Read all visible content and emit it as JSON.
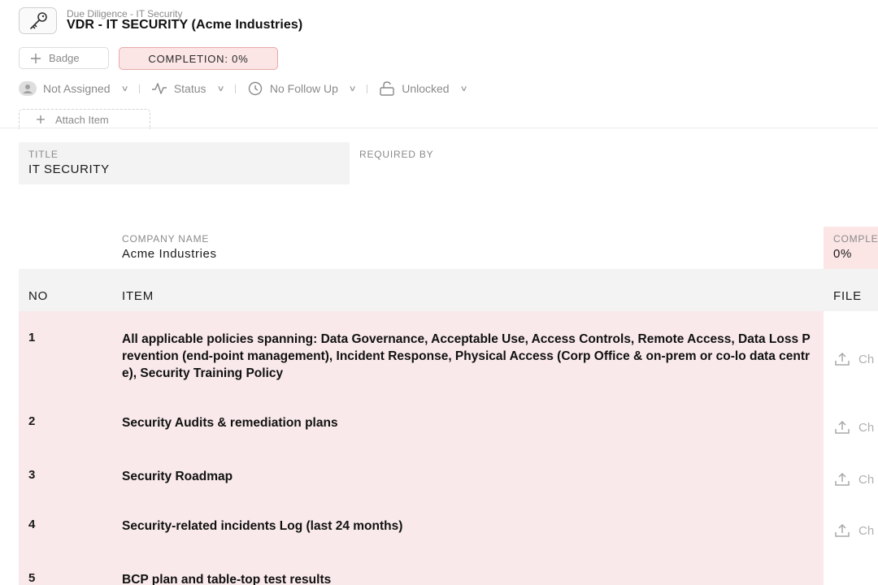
{
  "header": {
    "icon": "key-icon",
    "breadcrumb": "Due Diligence - IT Security",
    "title": "VDR - IT SECURITY (Acme Industries)"
  },
  "badge_button": {
    "label": "Badge",
    "icon": "plus-icon"
  },
  "completion_pill": {
    "label": "COMPLETION: 0%",
    "value_percent": 0
  },
  "properties": [
    {
      "label": "Not Assigned",
      "icon": "user-avatar-icon"
    },
    {
      "label": "Status",
      "icon": "activity-icon"
    },
    {
      "label": "No Follow Up",
      "icon": "clock-icon"
    },
    {
      "label": "Unlocked",
      "icon": "unlock-icon"
    }
  ],
  "attach_button": {
    "label": "Attach Item",
    "icon": "plus-icon"
  },
  "fields": {
    "title_label": "TITLE",
    "title_value": "IT SECURITY",
    "required_by_label": "REQUIRED BY",
    "company_name_label": "COMPANY NAME",
    "company_name_value": "Acme Industries",
    "completion_label": "COMPLETION",
    "completion_value": "0%"
  },
  "table": {
    "columns": [
      "NO",
      "ITEM",
      "FILE"
    ],
    "rows": [
      {
        "no": "1",
        "item": "All applicable policies spanning: Data Governance, Acceptable Use, Access Controls, Remote Access, Data Loss Prevention (end-point management), Incident Response, Physical Access (Corp Office & on-prem or co-lo data centre), Security Training Policy",
        "file": "Ch"
      },
      {
        "no": "2",
        "item": "Security Audits & remediation plans",
        "file": "Ch"
      },
      {
        "no": "3",
        "item": "Security Roadmap",
        "file": "Ch"
      },
      {
        "no": "4",
        "item": "Security-related incidents Log (last 24 months)",
        "file": "Ch"
      },
      {
        "no": "5",
        "item": "BCP plan and table-top test results",
        "file": ""
      }
    ]
  },
  "colors": {
    "accent_pink_bg": "#fbe5e5",
    "accent_pink_border": "#e9a9a9",
    "row_bg": "#f9e9ea",
    "muted_text": "#8a8a8a"
  }
}
